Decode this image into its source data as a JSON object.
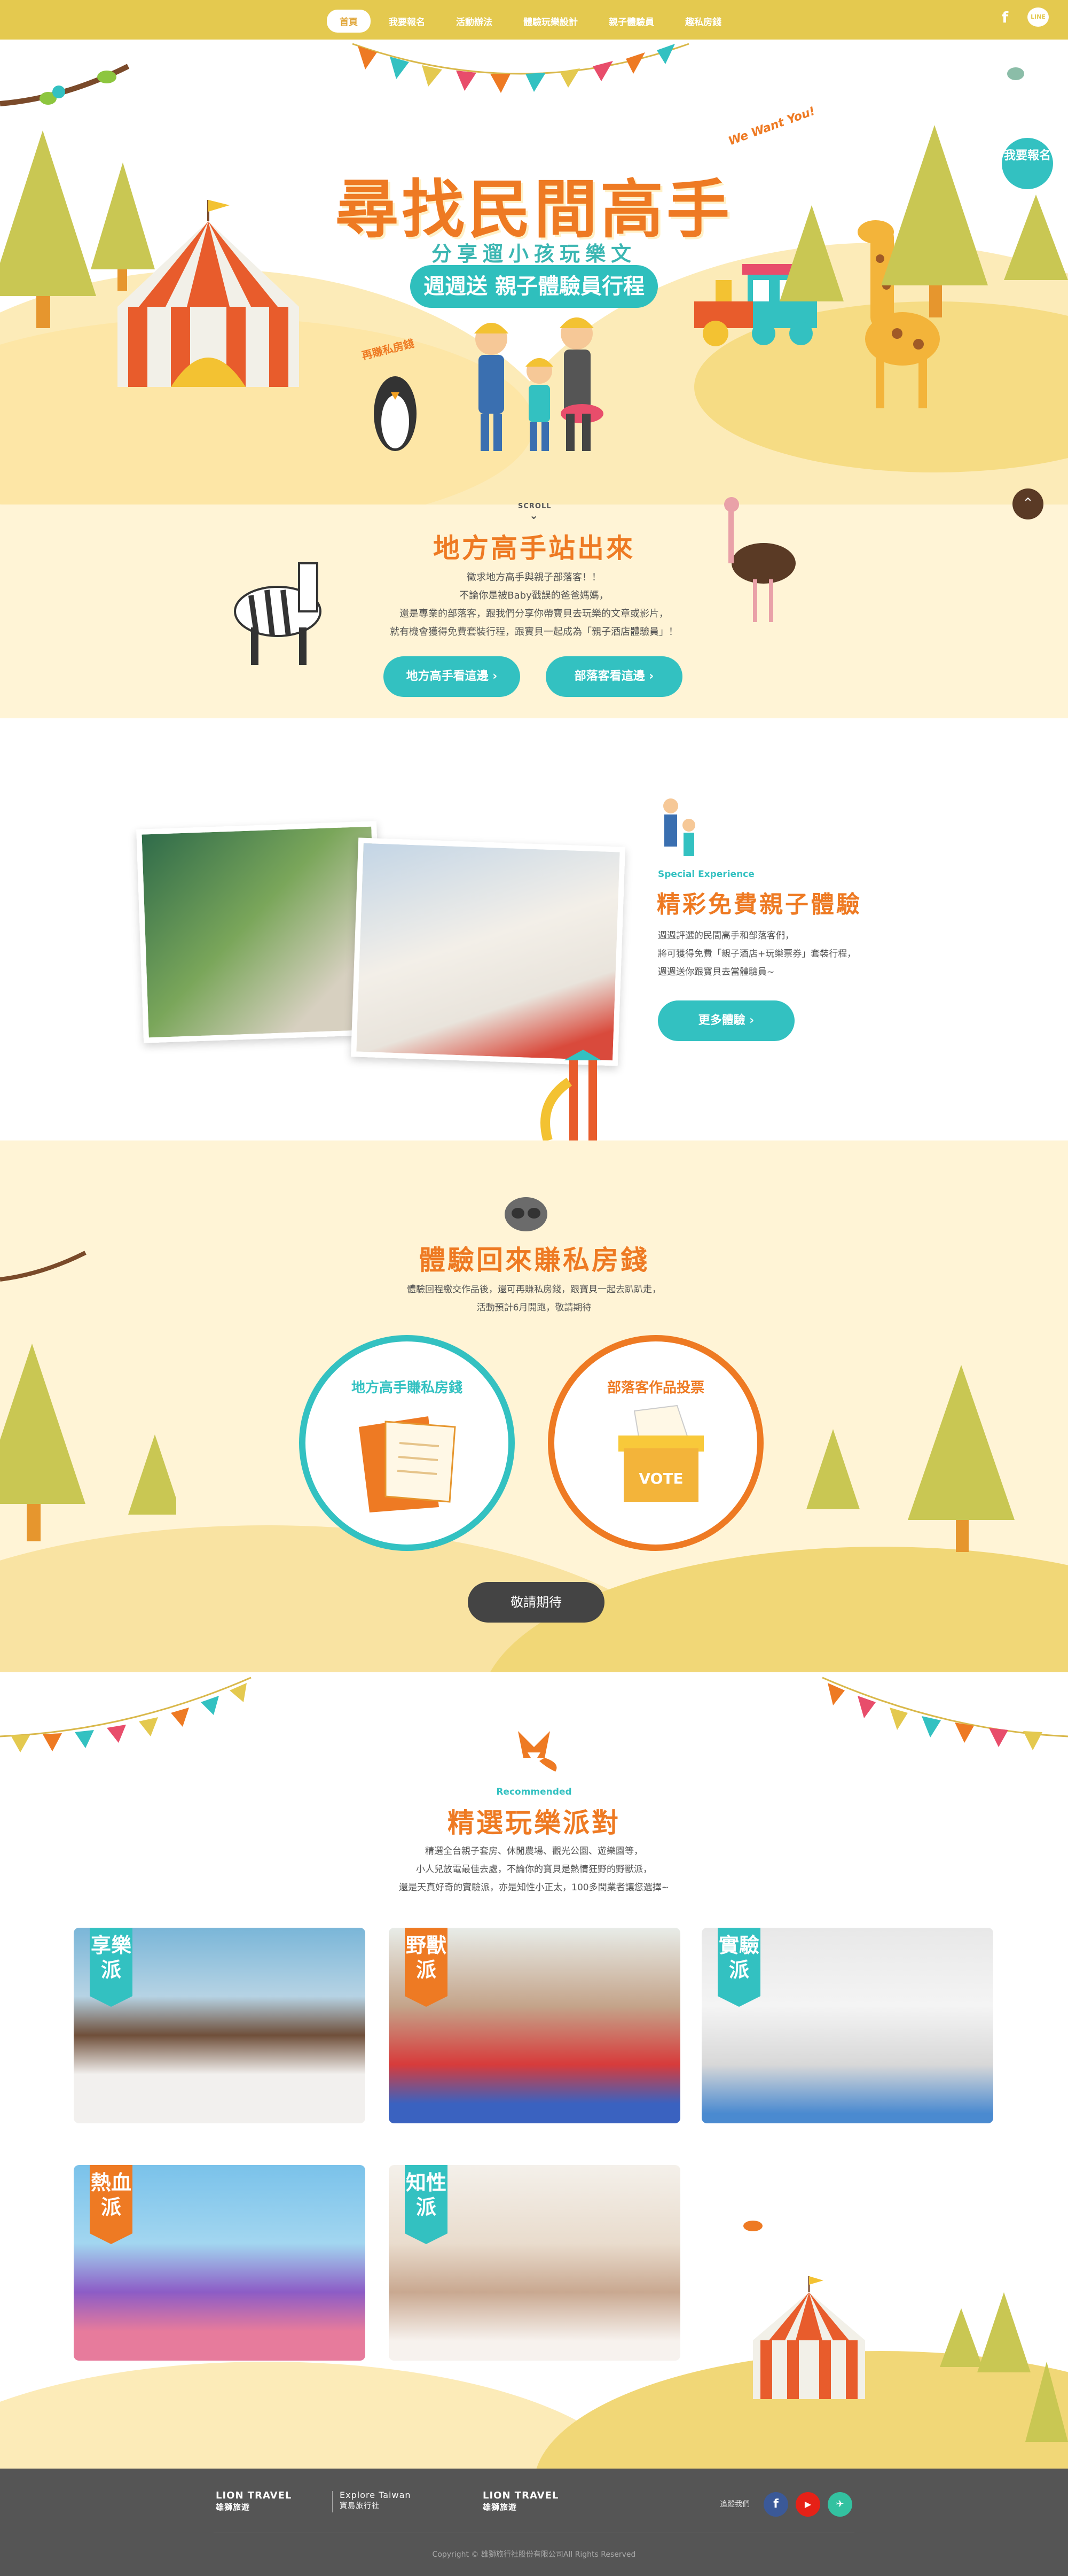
{
  "nav": {
    "items": [
      "首頁",
      "我要報名",
      "活動辦法",
      "體驗玩樂設計",
      "親子體驗員",
      "趣私房錢"
    ],
    "active_index": 0,
    "facebook_icon": "f",
    "line_icon": "LINE"
  },
  "hero": {
    "title": "尋找民間高手",
    "subtitle": "分享遛小孩玩樂文",
    "pill": "週週送 親子體驗員行程",
    "signup_button": "我要報名",
    "private_room_sign": "再賺私房錢",
    "we_want_you": "We Want You!",
    "scroll": "SCROLL"
  },
  "section1": {
    "title": "地方高手站出來",
    "text": [
      "徵求地方高手與親子部落客！！",
      "不論你是被Baby戳誤的爸爸媽媽，",
      "還是專業的部落客，跟我們分享你帶寶貝去玩樂的文章或影片，",
      "就有機會獲得免費套裝行程，跟寶貝一起成為「親子酒店體驗員」！"
    ],
    "button_left": "地方高手看這邊",
    "button_right": "部落客看這邊"
  },
  "section2": {
    "en_label": "Special Experience",
    "title": "精彩免費親子體驗",
    "text": [
      "週週評選的民間高手和部落客們，",
      "將可獲得免費「親子酒店+玩樂票券」套裝行程，",
      "週週送你跟寶貝去當體驗員~"
    ],
    "button": "更多體驗"
  },
  "section3": {
    "title": "體驗回來賺私房錢",
    "text": [
      "體驗回程繳交作品後，還可再賺私房錢，跟寶貝一起去趴趴走，",
      "活動預計6月開跑，敬請期待"
    ],
    "circle_left": "地方高手賺私房錢",
    "circle_right": "部落客作品投票",
    "vote_text": "VOTE",
    "button": "敬請期待"
  },
  "section4": {
    "en_label": "Recommended",
    "title": "精選玩樂派對",
    "text": [
      "精選全台親子套房、休閒農場、觀光公園、遊樂園等，",
      "小人兒放電最佳去處，不論你的寶貝是熱情狂野的野獸派，",
      "還是天真好奇的實驗派，亦是知性小正太，100多間業者讓您選擇~"
    ],
    "cards": [
      {
        "tag": "享樂派",
        "tag_color": "#33c1c1"
      },
      {
        "tag": "野獸派",
        "tag_color": "#ee7a23"
      },
      {
        "tag": "實驗派",
        "tag_color": "#33c1c1"
      },
      {
        "tag": "熱血派",
        "tag_color": "#ee7a23"
      },
      {
        "tag": "知性派",
        "tag_color": "#33c1c1"
      }
    ]
  },
  "footer": {
    "logo1_en": "LION TRAVEL",
    "logo1_zh": "雄獅旅遊",
    "explore_en": "Explore Taiwan",
    "explore_zh": "寶島旅行社",
    "logo2_en": "LION TRAVEL",
    "logo2_zh": "雄獅旅遊",
    "follow": "追蹤我們",
    "copyright": "Copyright © 雄獅旅行社股份有限公司All Rights Reserved"
  },
  "colors": {
    "nav_yellow": "#e4c94f",
    "orange": "#ee7a23",
    "teal": "#33c1c1",
    "cream": "#fff4d6",
    "footer_gray": "#555555"
  }
}
